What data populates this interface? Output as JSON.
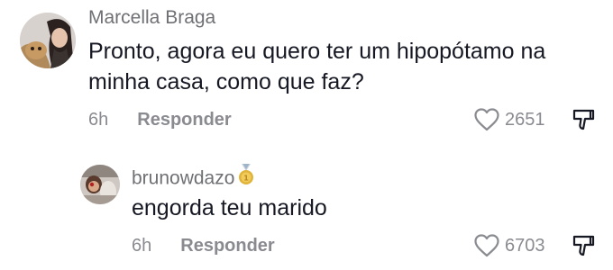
{
  "comments": [
    {
      "username": "Marcella Braga",
      "text": "Pronto, agora eu quero ter um hipopótamo na minha casa, como que faz?",
      "time": "6h",
      "reply_label": "Responder",
      "likes": "2651"
    },
    {
      "username": "brunowdazo",
      "badge_icon": "gold-medal-icon",
      "text": "engorda teu marido",
      "time": "6h",
      "reply_label": "Responder",
      "likes": "6703"
    }
  ],
  "colors": {
    "username": "#6f7074",
    "text": "#161823",
    "meta": "#8a8b91",
    "medal": "#e0b43a"
  }
}
